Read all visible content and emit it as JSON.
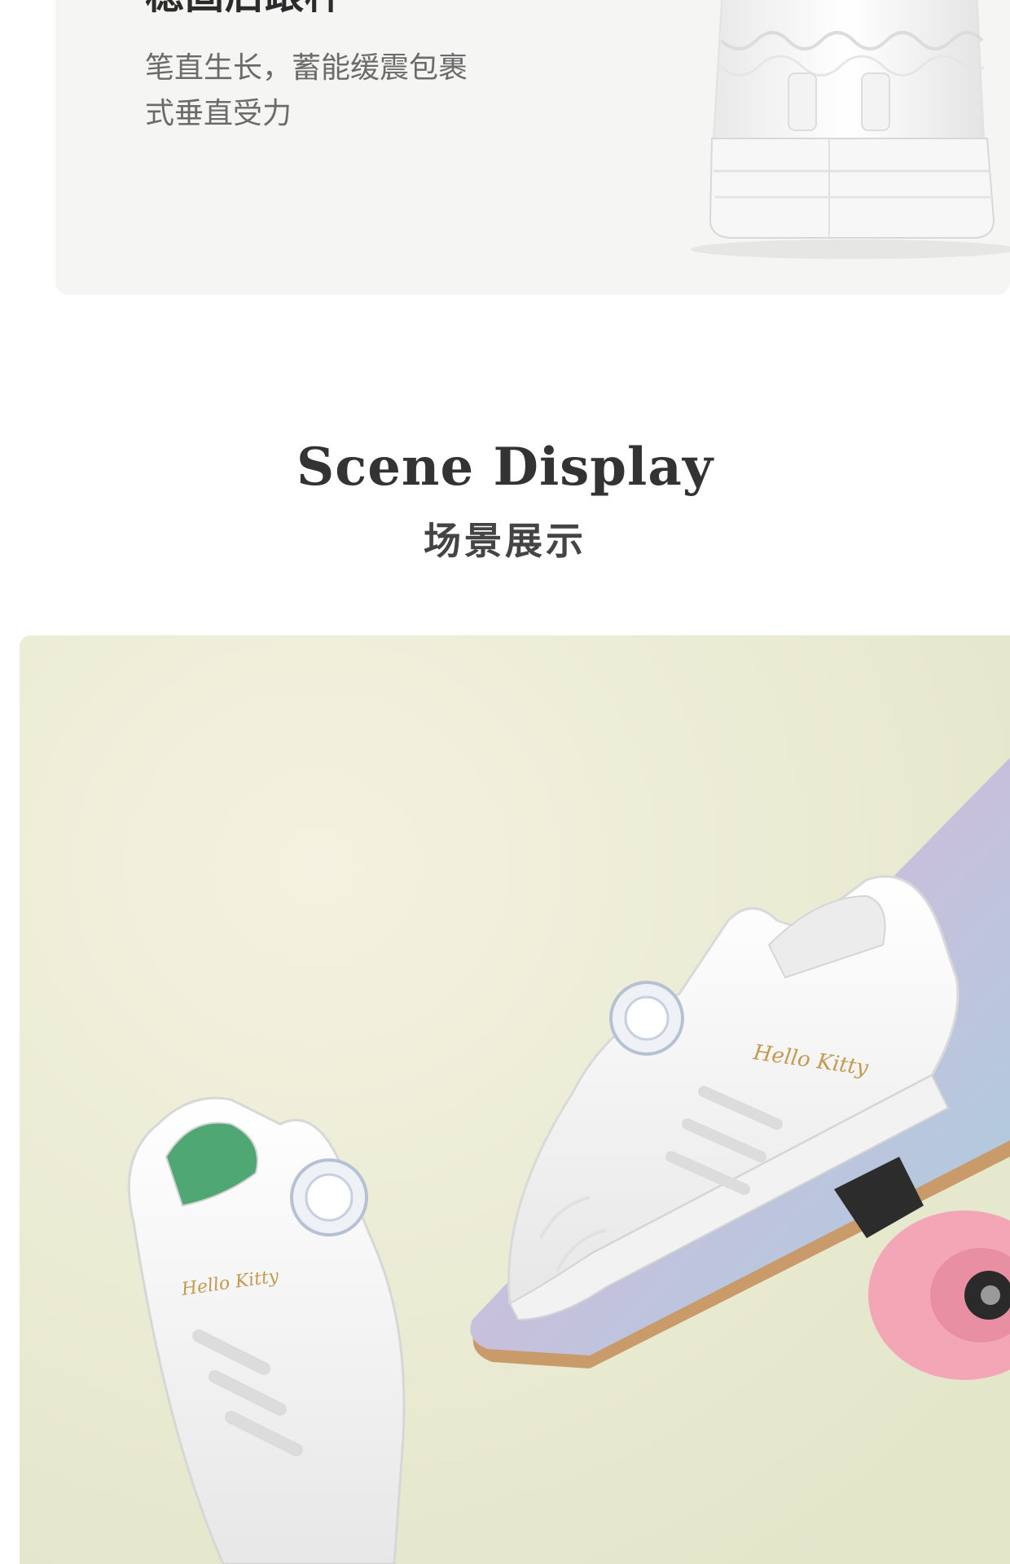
{
  "feature": {
    "title": "稳固后跟杯",
    "desc_line1": "笔直生长，蓄能缓震包裹",
    "desc_line2": "式垂直受力"
  },
  "scene": {
    "title_en": "Scene Display",
    "title_zh": "场景展示"
  },
  "brand_text": "Hello Kitty",
  "dial_text": "HELLO KITTY",
  "colors": {
    "card_bg": "#f5f5f4",
    "scene_bg": "#ecedd6",
    "wheel_pink": "#f2a6b6",
    "board_blue": "#a9cbd9",
    "shoe_white": "#f8f8f8"
  }
}
